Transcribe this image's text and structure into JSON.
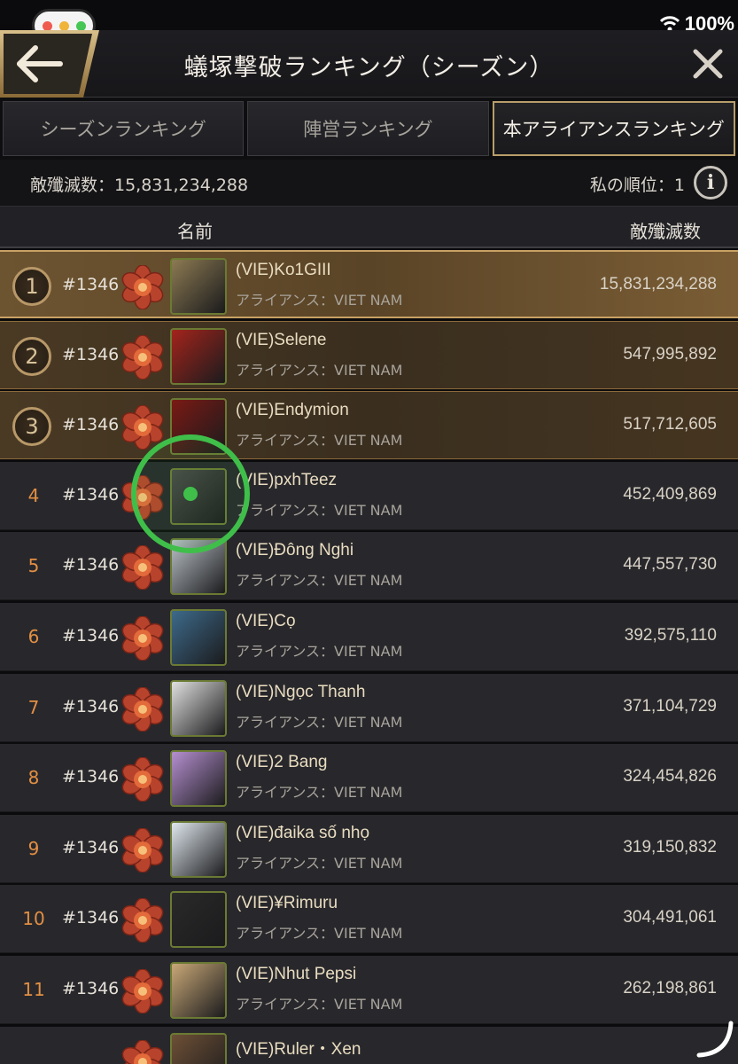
{
  "window_controls": {
    "colors": [
      "#ef5b4f",
      "#f0b43a",
      "#46c655"
    ]
  },
  "status": {
    "battery": "100%"
  },
  "header": {
    "title": "蟻塚撃破ランキング（シーズン）",
    "back_icon": "arrow-left-icon",
    "close_icon": "close-icon"
  },
  "tabs": [
    {
      "label": "シーズンランキング",
      "active": false
    },
    {
      "label": "陣営ランキング",
      "active": false
    },
    {
      "label": "本アライアンスランキング",
      "active": true
    }
  ],
  "summary": {
    "total_kills": "敵殲滅数：15,831,234,288",
    "my_rank": "私の順位：1"
  },
  "columns": {
    "name": "名前",
    "kills": "敵殲滅数"
  },
  "rows": [
    {
      "rank": "1",
      "server": "#1346",
      "name": "(VIE)Ko1GIII",
      "alliance": "アライアンス：VIET NAM",
      "kills": "15,831,234,288"
    },
    {
      "rank": "2",
      "server": "#1346",
      "name": "(VIE)Selene",
      "alliance": "アライアンス：VIET NAM",
      "kills": "547,995,892"
    },
    {
      "rank": "3",
      "server": "#1346",
      "name": "(VIE)Endymion",
      "alliance": "アライアンス：VIET NAM",
      "kills": "517,712,605"
    },
    {
      "rank": "4",
      "server": "#1346",
      "name": "(VIE)pxhTeez",
      "alliance": "アライアンス：VIET NAM",
      "kills": "452,409,869"
    },
    {
      "rank": "5",
      "server": "#1346",
      "name": "(VIE)Đông Nghi",
      "alliance": "アライアンス：VIET NAM",
      "kills": "447,557,730"
    },
    {
      "rank": "6",
      "server": "#1346",
      "name": "(VIE)Cọ",
      "alliance": "アライアンス：VIET NAM",
      "kills": "392,575,110"
    },
    {
      "rank": "7",
      "server": "#1346",
      "name": "(VIE)Ngọc Thanh",
      "alliance": "アライアンス：VIET NAM",
      "kills": "371,104,729"
    },
    {
      "rank": "8",
      "server": "#1346",
      "name": "(VIE)2 Bang",
      "alliance": "アライアンス：VIET NAM",
      "kills": "324,454,826"
    },
    {
      "rank": "9",
      "server": "#1346",
      "name": "(VIE)đaika số nhọ",
      "alliance": "アライアンス：VIET NAM",
      "kills": "319,150,832"
    },
    {
      "rank": "10",
      "server": "#1346",
      "name": "(VIE)¥Rimuru",
      "alliance": "アライアンス：VIET NAM",
      "kills": "304,491,061"
    },
    {
      "rank": "11",
      "server": "#1346",
      "name": "(VIE)Nhut Pepsi",
      "alliance": "アライアンス：VIET NAM",
      "kills": "262,198,861"
    },
    {
      "rank": "",
      "server": "",
      "name": "(VIE)Ruler・Xen",
      "alliance": "",
      "kills": ""
    }
  ],
  "avatar_colors": [
    "#8c7a52",
    "#a3241c",
    "#7a1a14",
    "#4a4a48",
    "#b9c0c6",
    "#3d6a8a",
    "#e0e0e0",
    "#b58fd0",
    "#dfe7ee",
    "#2a2a2a",
    "#c9a877",
    "#6e5036"
  ]
}
